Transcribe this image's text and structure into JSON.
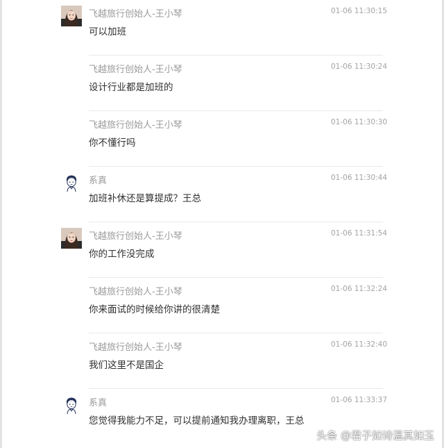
{
  "messages": [
    {
      "sender": "飞越旅行创始人-王小琴",
      "time": "01-06 11:30:15",
      "text": "可以加班",
      "avatar": "woman-photo-avatar"
    },
    {
      "sender": "飞越旅行创始人-王小琴",
      "time": "01-06 11:30:24",
      "text": "设计行业都是加班的",
      "avatar": ""
    },
    {
      "sender": "飞越旅行创始人-王小琴",
      "time": "01-06 11:30:30",
      "text": "你不懂行吗",
      "avatar": ""
    },
    {
      "sender": "系真",
      "time": "01-06 11:30:44",
      "text": "加班补休还是算提成？王总",
      "avatar": "cartoon-boy-avatar"
    },
    {
      "sender": "飞越旅行创始人-王小琴",
      "time": "01-06 11:31:54",
      "text": "你的工作没完成",
      "avatar": "woman-photo-avatar"
    },
    {
      "sender": "飞越旅行创始人-王小琴",
      "time": "01-06 11:32:24",
      "text": "你来面试的时候给你讲的很清楚",
      "avatar": ""
    },
    {
      "sender": "飞越旅行创始人-王小琴",
      "time": "01-06 11:32:40",
      "text": "我们这里不是国企",
      "avatar": ""
    },
    {
      "sender": "系真",
      "time": "01-06 11:33:37",
      "text": "您觉得我能力不足，可以提前通知我办理离职，王总",
      "avatar": "cartoon-boy-avatar"
    }
  ],
  "watermark": "头条 @君子如诗温其如玉",
  "colors": {
    "sender": "#9a9a9a",
    "time": "#a3a3a3",
    "text": "#2f2f2f",
    "divider": "#e9e9e9"
  }
}
